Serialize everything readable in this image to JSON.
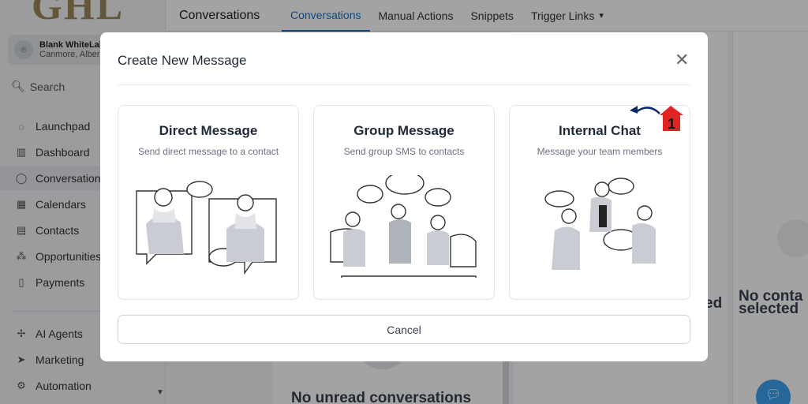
{
  "app": {
    "logo_text": "GHL"
  },
  "account": {
    "name": "Blank WhiteLab",
    "location": "Canmore, Alber"
  },
  "search": {
    "label": "Search"
  },
  "sidebar": {
    "items": [
      {
        "label": "Launchpad",
        "icon": "rocket-icon"
      },
      {
        "label": "Dashboard",
        "icon": "dashboard-icon"
      },
      {
        "label": "Conversations",
        "icon": "chat-icon"
      },
      {
        "label": "Calendars",
        "icon": "calendar-icon"
      },
      {
        "label": "Contacts",
        "icon": "contacts-icon"
      },
      {
        "label": "Opportunities",
        "icon": "opportunities-icon"
      },
      {
        "label": "Payments",
        "icon": "payments-icon"
      },
      {
        "label": "AI Agents",
        "icon": "sparkle-icon"
      },
      {
        "label": "Marketing",
        "icon": "send-icon"
      },
      {
        "label": "Automation",
        "icon": "automation-icon"
      }
    ]
  },
  "header": {
    "title": "Conversations",
    "tabs": [
      "Conversations",
      "Manual Actions",
      "Snippets",
      "Trigger Links"
    ]
  },
  "background": {
    "empty_conversations": "No unread conversations",
    "empty_partial": "ed",
    "no_contact_line1": "No conta",
    "no_contact_line2": "selected"
  },
  "modal": {
    "title": "Create New Message",
    "close_symbol": "✕",
    "cards": [
      {
        "title": "Direct Message",
        "subtitle": "Send direct message to a contact"
      },
      {
        "title": "Group Message",
        "subtitle": "Send group SMS to contacts"
      },
      {
        "title": "Internal Chat",
        "subtitle": "Message your team members"
      }
    ],
    "cancel_label": "Cancel"
  },
  "annotation": {
    "number": "1"
  },
  "colors": {
    "accent": "#1570c7",
    "marker": "#e02424",
    "fab": "#3ea0f0"
  }
}
